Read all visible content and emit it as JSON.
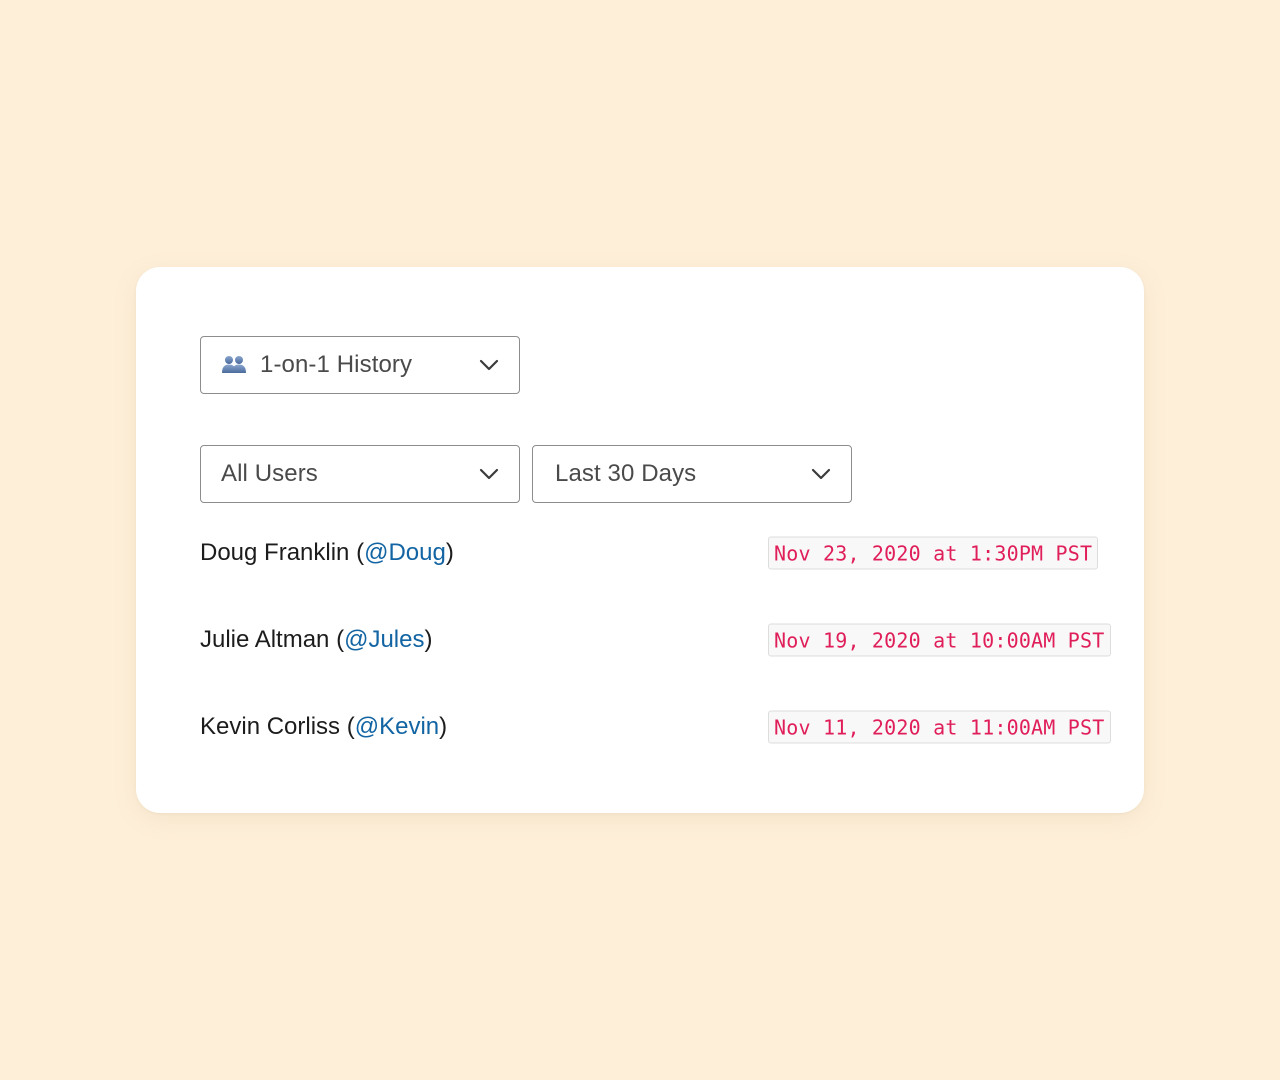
{
  "colors": {
    "background": "#feefd9",
    "card": "#ffffff",
    "link": "#1264a3",
    "date_text": "#e01e5a",
    "date_bg": "#f8f8f8"
  },
  "view_select": {
    "icon": "people-icon",
    "value": "1-on-1 History"
  },
  "filters": {
    "users": {
      "value": "All Users"
    },
    "range": {
      "value": "Last 30 Days"
    }
  },
  "history": [
    {
      "name": "Doug Franklin",
      "handle": "@Doug",
      "date": "Nov 23, 2020 at 1:30PM PST"
    },
    {
      "name": "Julie Altman",
      "handle": "@Jules",
      "date": "Nov 19, 2020 at 10:00AM PST"
    },
    {
      "name": "Kevin Corliss",
      "handle": "@Kevin",
      "date": "Nov 11, 2020 at 11:00AM PST"
    }
  ]
}
